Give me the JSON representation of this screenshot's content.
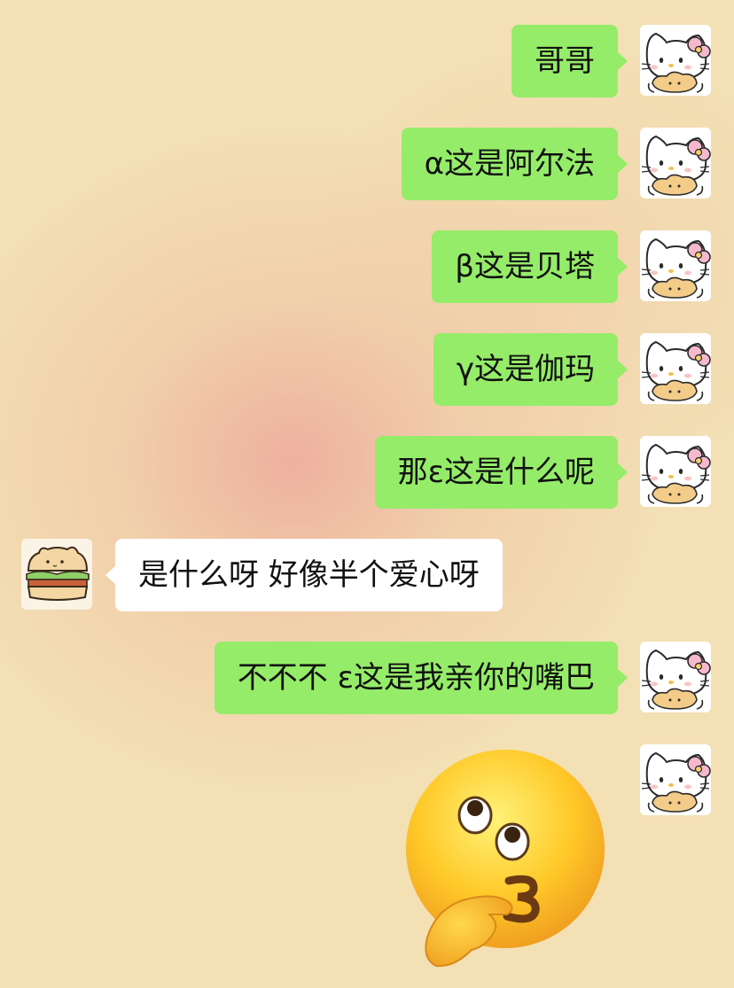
{
  "messages": [
    {
      "side": "me",
      "text": "哥哥"
    },
    {
      "side": "me",
      "text": "α这是阿尔法"
    },
    {
      "side": "me",
      "text": "β这是贝塔"
    },
    {
      "side": "me",
      "text": "γ这是伽玛"
    },
    {
      "side": "me",
      "text": "那ε这是什么呢"
    },
    {
      "side": "other",
      "text": "是什么呀 好像半个爱心呀"
    },
    {
      "side": "me",
      "text": "不不不 ε这是我亲你的嘴巴"
    },
    {
      "side": "me",
      "sticker": "thinking-kiss-emoji"
    }
  ],
  "avatars": {
    "me": "hello-kitty-avatar-icon",
    "other": "bear-sandwich-avatar-icon"
  },
  "colors": {
    "sent_bubble": "#95ec69",
    "received_bubble": "#ffffff",
    "background": "#f3e0b4"
  }
}
